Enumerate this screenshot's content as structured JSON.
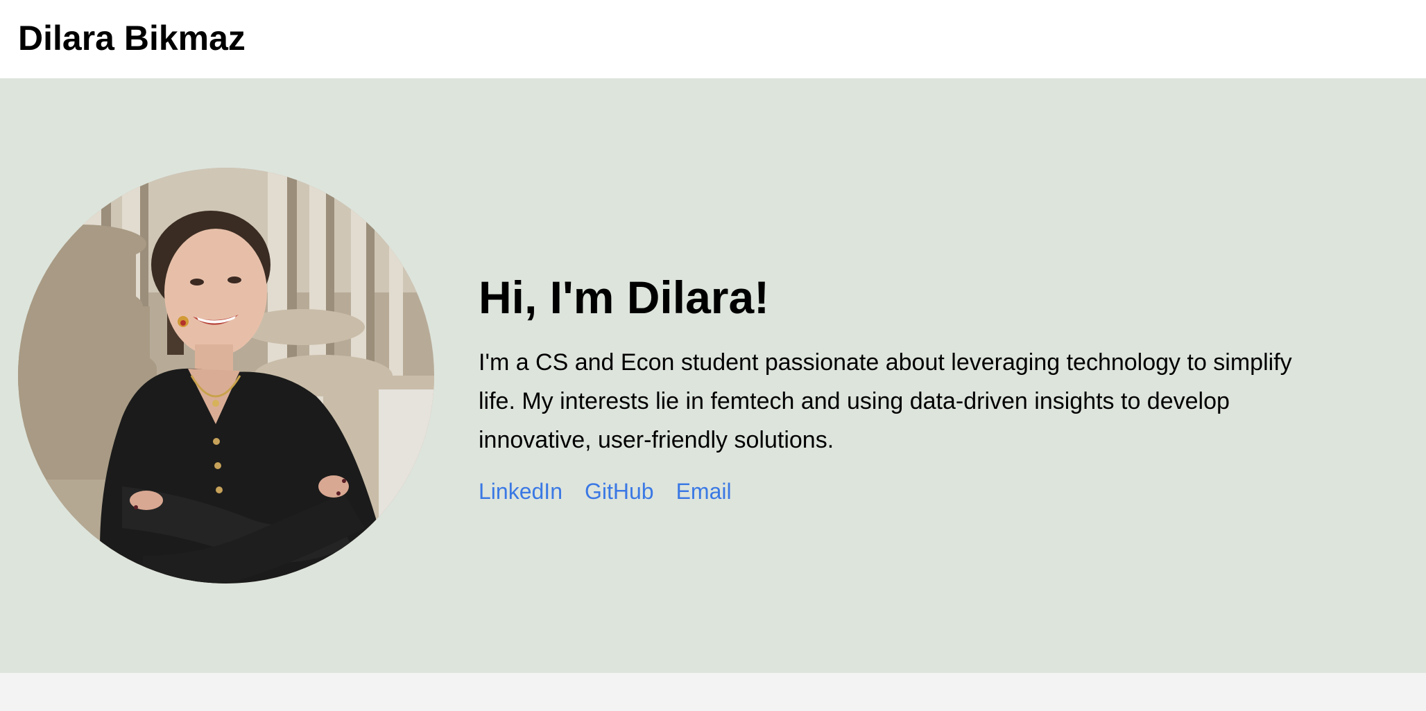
{
  "header": {
    "title": "Dilara Bikmaz"
  },
  "hero": {
    "heading": "Hi, I'm Dilara!",
    "bio": "I'm a CS and Econ student passionate about leveraging technology to simplify life. My interests lie in femtech and using data-driven insights to develop innovative, user-friendly solutions.",
    "links": {
      "linkedin": "LinkedIn",
      "github": "GitHub",
      "email": "Email"
    },
    "portrait_icon": "profile-photo"
  },
  "colors": {
    "header_bg": "#ffffff",
    "hero_bg": "#dde4dc",
    "page_bg": "#f3f3f3",
    "link": "#3a78e4",
    "text": "#000000"
  }
}
